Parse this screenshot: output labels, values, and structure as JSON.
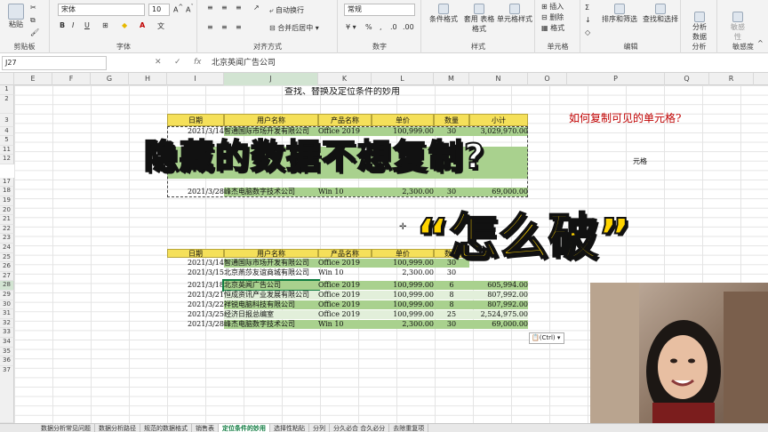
{
  "ribbon": {
    "clipboard": {
      "paste": "粘贴",
      "label": "剪贴板"
    },
    "font": {
      "name": "宋体",
      "size": "10",
      "bold": "B",
      "italic": "I",
      "underline": "U",
      "label": "字体"
    },
    "alignment": {
      "wrap": "自动换行",
      "merge": "合并后居中",
      "label": "对齐方式"
    },
    "number": {
      "format": "常规",
      "label": "数字"
    },
    "styles": {
      "conditional": "条件格式",
      "table": "套用\n表格格式",
      "cell_styles": "单元格样式",
      "label": "样式"
    },
    "cells": {
      "insert": "插入",
      "delete": "删除",
      "format": "格式",
      "label": "单元格"
    },
    "editing": {
      "sort": "排序和筛选",
      "find": "查找和选择",
      "label": "编辑"
    },
    "analysis": {
      "analyze": "分析\n数据",
      "label": "分析"
    },
    "sensitivity": {
      "btn": "敏感\n性",
      "label": "敏感度"
    }
  },
  "formula_bar": {
    "name_box": "J27",
    "cancel": "✕",
    "confirm": "✓",
    "fx": "fx",
    "content": "北京英闻广告公司"
  },
  "columns": [
    "E",
    "F",
    "G",
    "H",
    "I",
    "J",
    "K",
    "L",
    "M",
    "N",
    "O",
    "P",
    "Q",
    "R"
  ],
  "rows": [
    "1",
    "2",
    "3",
    "4",
    "5",
    "11",
    "12",
    "17",
    "18",
    "19",
    "20",
    "21",
    "22",
    "23",
    "24",
    "25",
    "26",
    "27",
    "28",
    "29",
    "30",
    "31",
    "32",
    "33",
    "34",
    "35",
    "36",
    "37"
  ],
  "sheet_title": "查找、替换及定位条件的妙用",
  "table_headers": [
    "日期",
    "用户名称",
    "产品名称",
    "单价",
    "数量",
    "小计"
  ],
  "top_table": [
    {
      "date": "2021/3/14",
      "user": "智通国际市场开发有限公司",
      "product": "Office 2019",
      "price": "100,999.00",
      "qty": "30",
      "subtotal": "3,029,970.00"
    },
    {
      "date": "2021/3/28",
      "user": "峰杰电脑数字技术公司",
      "product": "Win 10",
      "price": "2,300.00",
      "qty": "30",
      "subtotal": "69,000.00"
    }
  ],
  "bottom_table": [
    {
      "date": "2021/3/14",
      "user": "智通国际市场开发有限公司",
      "product": "Office 2019",
      "price": "100,999.00",
      "qty": "30",
      "subtotal": ""
    },
    {
      "date": "2021/3/15",
      "user": "北京燕莎友谊商城有限公司",
      "product": "Win 10",
      "price": "2,300.00",
      "qty": "30",
      "subtotal": ""
    },
    {
      "date": "2021/3/18",
      "user": "北京英闻广告公司",
      "product": "Office 2019",
      "price": "100,999.00",
      "qty": "6",
      "subtotal": "605,994.00"
    },
    {
      "date": "2021/3/21",
      "user": "恒成资讯产业发展有限公司",
      "product": "Office 2019",
      "price": "100,999.00",
      "qty": "8",
      "subtotal": "807,992.00"
    },
    {
      "date": "2021/3/22",
      "user": "祥锐电脑科技有限公司",
      "product": "Office 2019",
      "price": "100,999.00",
      "qty": "8",
      "subtotal": "807,992.00"
    },
    {
      "date": "2021/3/25",
      "user": "经济日报总编室",
      "product": "Office 2019",
      "price": "100,999.00",
      "qty": "25",
      "subtotal": "2,524,975.00"
    },
    {
      "date": "2021/3/28",
      "user": "峰杰电脑数字技术公司",
      "product": "Win 10",
      "price": "2,300.00",
      "qty": "30",
      "subtotal": "69,000.00"
    }
  ],
  "side_question": "如何复制可见的单元格?",
  "side_fragment": "元格",
  "paste_options": "(Ctrl) ▾",
  "overlay_line1": "隐藏的数据不想复制?",
  "overlay_line2": "“怎么破”",
  "sheet_tabs": [
    "数据分析常见问题",
    "数据分析路径",
    "规范的数据格式",
    "销售表",
    "定位条件的妙用",
    "选择性粘贴",
    "分列",
    "分久必合 合久必分",
    "去除重复项"
  ],
  "active_tab_index": 4
}
